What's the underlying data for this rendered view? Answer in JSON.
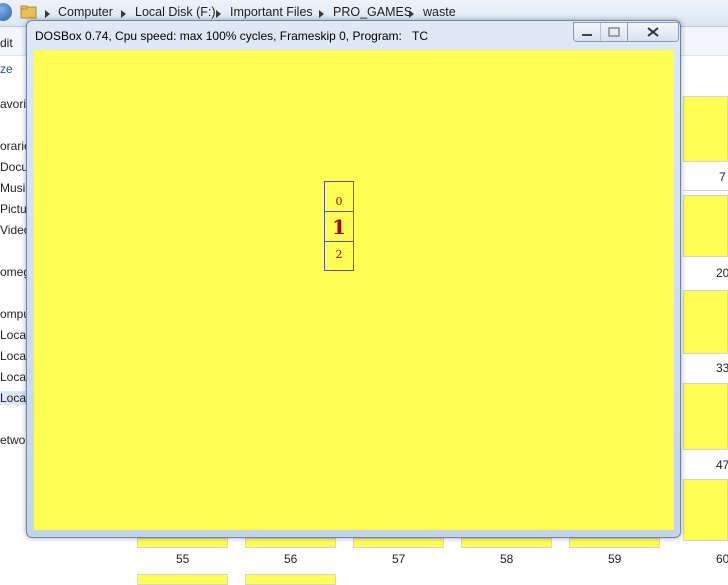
{
  "explorer": {
    "breadcrumbs": [
      "Computer",
      "Local Disk (F:)",
      "Important Files",
      "PRO_GAMES",
      "waste"
    ],
    "toolbar_edit": "dit",
    "organize": "ze",
    "sidebar": [
      "avorite",
      "orarie",
      "Docu",
      "Musi",
      "Pictu",
      "Video",
      "omeg",
      "ompu",
      "Local",
      "Local",
      "Local",
      "Local",
      "etwor"
    ],
    "right_numbers": [
      "7",
      "20",
      "33",
      "47"
    ],
    "bottom_labels": [
      "55",
      "56",
      "57",
      "58",
      "59",
      "60"
    ]
  },
  "dosbox": {
    "title": "DOSBox 0.74, Cpu speed: max 100% cycles, Frameskip  0, Program:",
    "program": "TC",
    "minimize_icon": "minimize-icon",
    "maximize_icon": "maximize-icon",
    "close_icon": "close-icon",
    "screen_color": "#ffff55",
    "menu_items": [
      "0",
      "1",
      "2"
    ],
    "selected_index": 1
  }
}
